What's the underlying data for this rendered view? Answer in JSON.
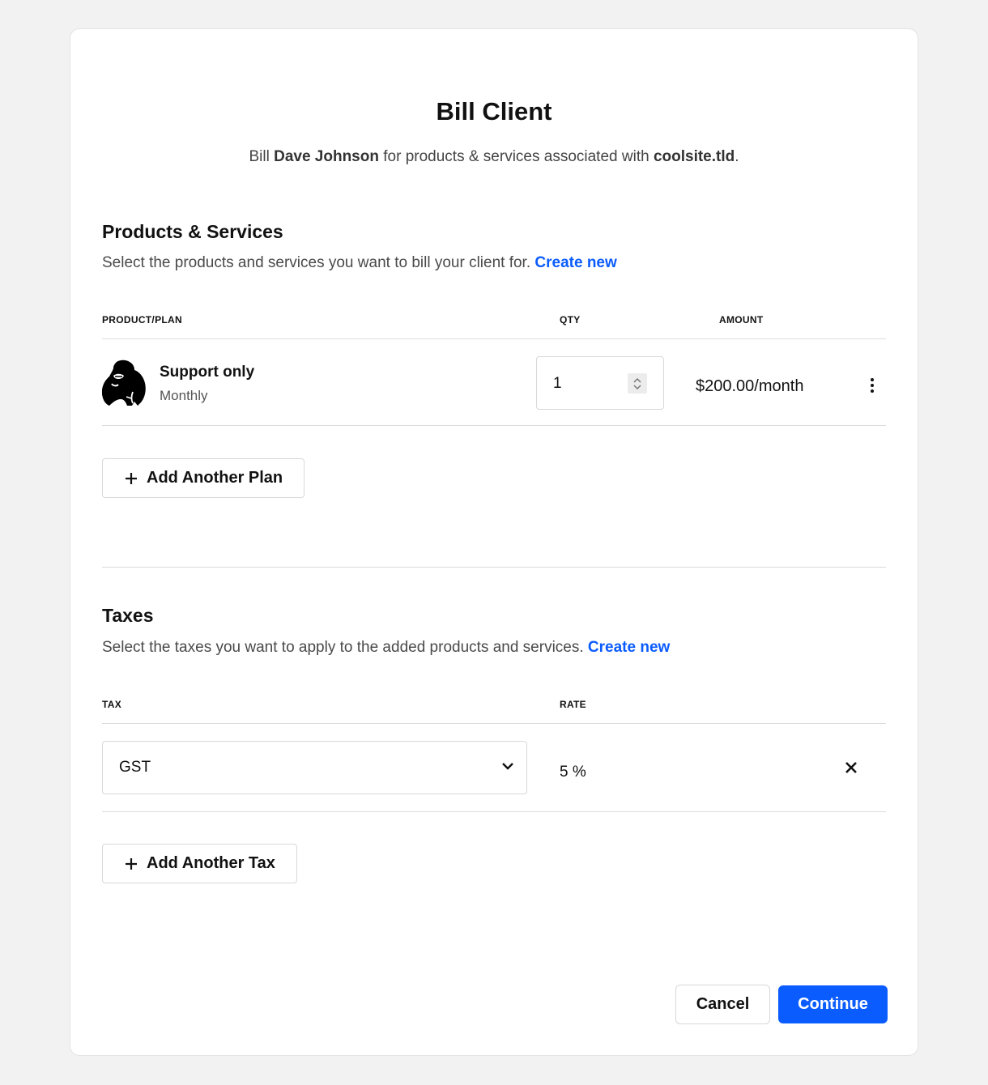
{
  "dialog": {
    "title": "Bill Client",
    "subtitle_prefix": "Bill ",
    "client_name": "Dave Johnson",
    "subtitle_middle": " for products & services associated with ",
    "site": "coolsite.tld",
    "subtitle_suffix": "."
  },
  "products": {
    "heading": "Products & Services",
    "description": "Select the products and services you want to bill your client for.",
    "create_link": "Create new",
    "columns": {
      "plan": "PRODUCT/PLAN",
      "qty": "QTY",
      "amount": "AMOUNT"
    },
    "rows": [
      {
        "name": "Support only",
        "cycle": "Monthly",
        "qty": "1",
        "amount": "$200.00/month",
        "logo_icon": "gorilla-logo-icon"
      }
    ],
    "add_button": "Add Another Plan"
  },
  "taxes": {
    "heading": "Taxes",
    "description": "Select the taxes you want to apply to the added products and services.",
    "create_link": "Create new",
    "columns": {
      "tax": "TAX",
      "rate": "RATE"
    },
    "rows": [
      {
        "selected": "GST",
        "rate": "5 %"
      }
    ],
    "add_button": "Add Another Tax"
  },
  "footer": {
    "cancel_label": "Cancel",
    "continue_label": "Continue"
  },
  "colors": {
    "accent": "#0b5cff",
    "background": "#f2f2f2",
    "card": "#ffffff"
  }
}
